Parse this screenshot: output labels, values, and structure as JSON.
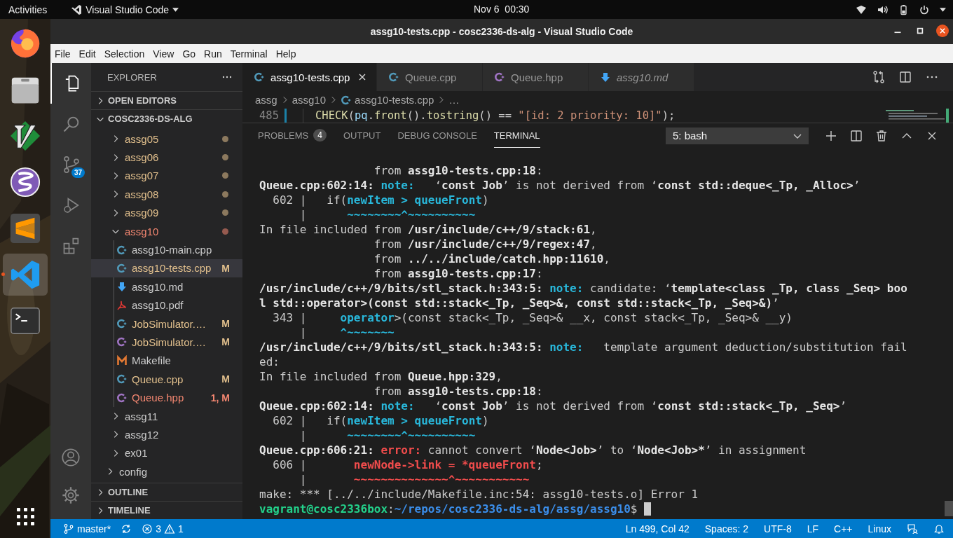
{
  "topbar": {
    "activities": "Activities",
    "app": "Visual Studio Code",
    "clock": "Nov 6  00:30"
  },
  "dock": [
    {
      "kind": "browser",
      "running": false
    },
    {
      "kind": "files",
      "running": false
    },
    {
      "kind": "vim",
      "running": false
    },
    {
      "kind": "emacs",
      "running": false
    },
    {
      "kind": "sublime",
      "running": false
    },
    {
      "kind": "vscode",
      "running": true
    },
    {
      "kind": "terminal",
      "running": false
    }
  ],
  "window": {
    "title": "assg10-tests.cpp - cosc2336-ds-alg - Visual Studio Code"
  },
  "menu": [
    "File",
    "Edit",
    "Selection",
    "View",
    "Go",
    "Run",
    "Terminal",
    "Help"
  ],
  "activity_bar": [
    {
      "kind": "explorer",
      "selected": true
    },
    {
      "kind": "search",
      "selected": false
    },
    {
      "kind": "source-control",
      "selected": false,
      "badge": "37"
    },
    {
      "kind": "run",
      "selected": false
    },
    {
      "kind": "extensions",
      "selected": false
    }
  ],
  "activity_bar_bottom": [
    {
      "kind": "account"
    },
    {
      "kind": "settings"
    }
  ],
  "sidebar": {
    "title": "EXPLORER",
    "sections": [
      {
        "label": "OPEN EDITORS",
        "expanded": false
      },
      {
        "label": "COSC2336-DS-ALG",
        "expanded": true,
        "items": [
          {
            "kind": "scrolled-folder",
            "children": [
              {
                "kind": "folder",
                "name": "assg05",
                "expanded": false,
                "color": "#e2c08d",
                "dot": true
              },
              {
                "kind": "folder",
                "name": "assg06",
                "expanded": false,
                "color": "#e2c08d",
                "dot": true
              },
              {
                "kind": "folder",
                "name": "assg07",
                "expanded": false,
                "color": "#e2c08d",
                "dot": true
              },
              {
                "kind": "folder",
                "name": "assg08",
                "expanded": false,
                "color": "#e2c08d",
                "dot": true
              },
              {
                "kind": "folder",
                "name": "assg09",
                "expanded": false,
                "color": "#e2c08d",
                "dot": true
              },
              {
                "kind": "folder",
                "name": "assg10",
                "expanded": true,
                "color": "#f48771",
                "dot": true,
                "children": [
                  {
                    "kind": "cpp",
                    "name": "assg10-main.cpp",
                    "color": "#cccccc",
                    "selected": false
                  },
                  {
                    "kind": "cpp",
                    "name": "assg10-tests.cpp",
                    "color": "#e2c08d",
                    "status": "M",
                    "selected": true
                  },
                  {
                    "kind": "md",
                    "name": "assg10.md",
                    "color": "#cccccc",
                    "selected": false
                  },
                  {
                    "kind": "pdf",
                    "name": "assg10.pdf",
                    "color": "#cccccc",
                    "selected": false
                  },
                  {
                    "kind": "cpp",
                    "name": "JobSimulator.…",
                    "color": "#e2c08d",
                    "status": "M",
                    "selected": false
                  },
                  {
                    "kind": "hpp",
                    "name": "JobSimulator.…",
                    "color": "#e2c08d",
                    "status": "M",
                    "selected": false
                  },
                  {
                    "kind": "makefile",
                    "name": "Makefile",
                    "color": "#cccccc",
                    "selected": false
                  },
                  {
                    "kind": "cpp",
                    "name": "Queue.cpp",
                    "color": "#e2c08d",
                    "status": "M",
                    "selected": false
                  },
                  {
                    "kind": "hpp",
                    "name": "Queue.hpp",
                    "color": "#f48771",
                    "status": "1, M",
                    "selected": false
                  }
                ]
              },
              {
                "kind": "folder",
                "name": "assg11",
                "expanded": false,
                "color": "#cccccc",
                "dot": false
              },
              {
                "kind": "folder",
                "name": "assg12",
                "expanded": false,
                "color": "#cccccc",
                "dot": false
              },
              {
                "kind": "folder",
                "name": "ex01",
                "expanded": false,
                "color": "#cccccc",
                "dot": false
              }
            ]
          },
          {
            "kind": "folder",
            "name": "config",
            "expanded": false,
            "color": "#cccccc",
            "dot": false
          }
        ]
      },
      {
        "label": "OUTLINE",
        "expanded": false
      },
      {
        "label": "TIMELINE",
        "expanded": false
      }
    ]
  },
  "tabs": [
    {
      "kind": "cpp",
      "label": "assg10-tests.cpp",
      "selected": true,
      "preview": false
    },
    {
      "kind": "cpp",
      "label": "Queue.cpp",
      "selected": false,
      "preview": false
    },
    {
      "kind": "hpp",
      "label": "Queue.hpp",
      "selected": false,
      "preview": false
    },
    {
      "kind": "md",
      "label": "assg10.md",
      "selected": false,
      "preview": true
    }
  ],
  "breadcrumbs": [
    {
      "label": "assg"
    },
    {
      "label": "assg10"
    },
    {
      "label": "assg10-tests.cpp",
      "kind": "cpp"
    },
    {
      "label": "…"
    }
  ],
  "editor": {
    "line_number": "485",
    "modified": true,
    "code": [
      {
        "text": "CHECK",
        "kind": "func"
      },
      {
        "text": "(",
        "kind": "plain"
      },
      {
        "text": "pq",
        "kind": "var"
      },
      {
        "text": ".",
        "kind": "plain"
      },
      {
        "text": "front",
        "kind": "func"
      },
      {
        "text": "().",
        "kind": "plain"
      },
      {
        "text": "tostring",
        "kind": "func"
      },
      {
        "text": "() == ",
        "kind": "plain"
      },
      {
        "text": "\"[id: 2 priority: 10]\"",
        "kind": "string"
      },
      {
        "text": ");",
        "kind": "plain"
      }
    ]
  },
  "panel": {
    "tabs": [
      {
        "label": "PROBLEMS",
        "badge": "4",
        "selected": false
      },
      {
        "label": "OUTPUT",
        "selected": false
      },
      {
        "label": "DEBUG CONSOLE",
        "selected": false
      },
      {
        "label": "TERMINAL",
        "selected": true
      }
    ],
    "terminal_select": "5: bash",
    "cursor": true,
    "lines": [
      [
        {
          "text": "                 from ",
          "kind": "plain"
        },
        {
          "text": "assg10-tests.cpp:18",
          "kind": "bold"
        },
        {
          "text": ":",
          "kind": "plain"
        }
      ],
      [
        {
          "text": "Queue.cpp:602:14:",
          "kind": "bold"
        },
        {
          "text": " note:",
          "kind": "note"
        },
        {
          "text": "   ‘",
          "kind": "plain"
        },
        {
          "text": "const Job",
          "kind": "bold"
        },
        {
          "text": "’ is not derived from ‘",
          "kind": "plain"
        },
        {
          "text": "const std::deque<_Tp, _Alloc>",
          "kind": "bold"
        },
        {
          "text": "’",
          "kind": "plain"
        }
      ],
      [
        {
          "text": "  602 |   if(",
          "kind": "plain"
        },
        {
          "text": "newItem > queueFront",
          "kind": "code"
        },
        {
          "text": ")",
          "kind": "plain"
        }
      ],
      [
        {
          "text": "      |      ",
          "kind": "plain"
        },
        {
          "text": "~~~~~~~~^~~~~~~~~~~",
          "kind": "code"
        }
      ],
      [
        {
          "text": "In file included from ",
          "kind": "plain"
        },
        {
          "text": "/usr/include/c++/9/stack:61",
          "kind": "bold"
        },
        {
          "text": ",",
          "kind": "plain"
        }
      ],
      [
        {
          "text": "                 from ",
          "kind": "plain"
        },
        {
          "text": "/usr/include/c++/9/regex:47",
          "kind": "bold"
        },
        {
          "text": ",",
          "kind": "plain"
        }
      ],
      [
        {
          "text": "                 from ",
          "kind": "plain"
        },
        {
          "text": "../../include/catch.hpp:11610",
          "kind": "bold"
        },
        {
          "text": ",",
          "kind": "plain"
        }
      ],
      [
        {
          "text": "                 from ",
          "kind": "plain"
        },
        {
          "text": "assg10-tests.cpp:17",
          "kind": "bold"
        },
        {
          "text": ":",
          "kind": "plain"
        }
      ],
      [
        {
          "text": "/usr/include/c++/9/bits/stl_stack.h:343:5:",
          "kind": "bold"
        },
        {
          "text": " note:",
          "kind": "note"
        },
        {
          "text": " candidate: ‘",
          "kind": "plain"
        },
        {
          "text": "template<class _Tp, class _Seq> boo",
          "kind": "bold"
        }
      ],
      [
        {
          "text": "l std::operator>(const std::stack<_Tp, _Seq>&, const std::stack<_Tp, _Seq>&)",
          "kind": "bold"
        },
        {
          "text": "’",
          "kind": "plain"
        }
      ],
      [
        {
          "text": "  343 |     ",
          "kind": "plain"
        },
        {
          "text": "operator",
          "kind": "code"
        },
        {
          "text": ">(const stack<_Tp, _Seq>& __x, const stack<_Tp, _Seq>& __y)",
          "kind": "plain"
        }
      ],
      [
        {
          "text": "      |     ",
          "kind": "plain"
        },
        {
          "text": "^~~~~~~~",
          "kind": "code"
        }
      ],
      [
        {
          "text": "/usr/include/c++/9/bits/stl_stack.h:343:5:",
          "kind": "bold"
        },
        {
          "text": " note:",
          "kind": "note"
        },
        {
          "text": "   template argument deduction/substitution fail",
          "kind": "plain"
        }
      ],
      [
        {
          "text": "ed:",
          "kind": "plain"
        }
      ],
      [
        {
          "text": "In file included from ",
          "kind": "plain"
        },
        {
          "text": "Queue.hpp:329",
          "kind": "bold"
        },
        {
          "text": ",",
          "kind": "plain"
        }
      ],
      [
        {
          "text": "                 from ",
          "kind": "plain"
        },
        {
          "text": "assg10-tests.cpp:18",
          "kind": "bold"
        },
        {
          "text": ":",
          "kind": "plain"
        }
      ],
      [
        {
          "text": "Queue.cpp:602:14:",
          "kind": "bold"
        },
        {
          "text": " note:",
          "kind": "note"
        },
        {
          "text": "   ‘",
          "kind": "plain"
        },
        {
          "text": "const Job",
          "kind": "bold"
        },
        {
          "text": "’ is not derived from ‘",
          "kind": "plain"
        },
        {
          "text": "const std::stack<_Tp, _Seq>",
          "kind": "bold"
        },
        {
          "text": "’",
          "kind": "plain"
        }
      ],
      [
        {
          "text": "  602 |   if(",
          "kind": "plain"
        },
        {
          "text": "newItem > queueFront",
          "kind": "code"
        },
        {
          "text": ")",
          "kind": "plain"
        }
      ],
      [
        {
          "text": "      |      ",
          "kind": "plain"
        },
        {
          "text": "~~~~~~~~^~~~~~~~~~~",
          "kind": "code"
        }
      ],
      [
        {
          "text": "Queue.cpp:606:21:",
          "kind": "bold"
        },
        {
          "text": " error:",
          "kind": "error"
        },
        {
          "text": " cannot convert ‘",
          "kind": "plain"
        },
        {
          "text": "Node<Job>",
          "kind": "bold"
        },
        {
          "text": "’ to ‘",
          "kind": "plain"
        },
        {
          "text": "Node<Job>*",
          "kind": "bold"
        },
        {
          "text": "’ in assignment",
          "kind": "plain"
        }
      ],
      [
        {
          "text": "  606 |       ",
          "kind": "plain"
        },
        {
          "text": "newNode->link = *queueFront",
          "kind": "error"
        },
        {
          "text": ";",
          "kind": "plain"
        }
      ],
      [
        {
          "text": "      |       ",
          "kind": "plain"
        },
        {
          "text": "~~~~~~~~~~~~~~^~~~~~~~~~~~",
          "kind": "error"
        }
      ],
      [
        {
          "text": "make: *** [../../include/Makefile.inc:54: assg10-tests.o] Error 1",
          "kind": "plain"
        }
      ],
      [
        {
          "text": "vagrant@cosc2336box",
          "kind": "prompt"
        },
        {
          "text": ":",
          "kind": "plain"
        },
        {
          "text": "~/repos/cosc2336-ds-alg/assg/assg10",
          "kind": "path"
        },
        {
          "text": "$",
          "kind": "plain"
        }
      ]
    ]
  },
  "status_bar": {
    "branch": "master*",
    "errors": "3",
    "warnings": "1",
    "right": [
      "Ln 499, Col 42",
      "Spaces: 2",
      "UTF-8",
      "LF",
      "C++",
      "Linux"
    ]
  }
}
